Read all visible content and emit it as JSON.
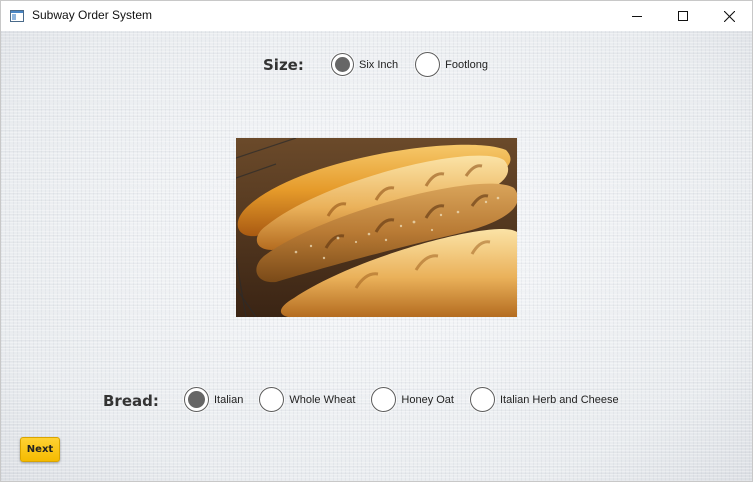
{
  "window": {
    "title": "Subway Order System",
    "icon": "window-app-icon",
    "controls": [
      "minimize-icon",
      "maximize-icon",
      "close-icon"
    ]
  },
  "size": {
    "label": "Size:",
    "selected": "Six Inch",
    "options": [
      {
        "label": "Six Inch",
        "selected": true
      },
      {
        "label": "Footlong",
        "selected": false
      }
    ]
  },
  "image": {
    "description_icon": "bread-loaves-photo"
  },
  "bread": {
    "label": "Bread:",
    "selected": "Italian",
    "options": [
      {
        "label": "Italian",
        "selected": true
      },
      {
        "label": "Whole Wheat",
        "selected": false
      },
      {
        "label": "Honey Oat",
        "selected": false
      },
      {
        "label": "Italian Herb and Cheese",
        "selected": false
      }
    ]
  },
  "actions": {
    "next_label": "Next"
  },
  "colors": {
    "next_button": "#f7c000",
    "radio_selected_dot": "#666666",
    "label_text": "#333333"
  }
}
